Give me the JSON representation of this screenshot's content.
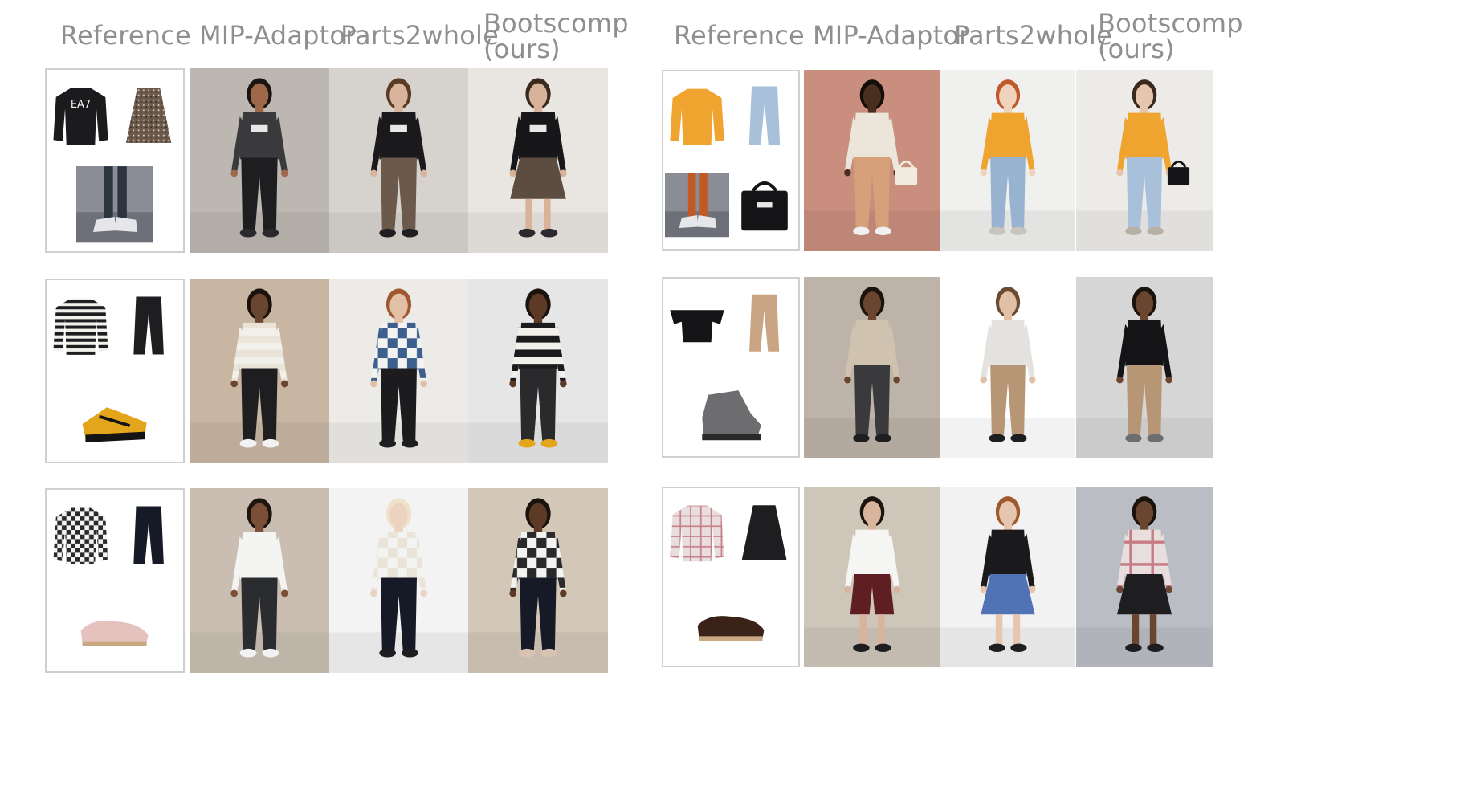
{
  "panels": [
    {
      "headers": [
        "Reference",
        "MIP-Adaptor",
        "Parts2whole",
        "Bootscomp",
        "(ours)"
      ],
      "rows": [
        {
          "ref_items": [
            {
              "kind": "top",
              "color": "#1b1b1d",
              "pattern": "logo",
              "label": "EA7"
            },
            {
              "kind": "skirt",
              "color": "#6b5a4c",
              "pattern": "speckle"
            },
            {
              "kind": "shoe-photo",
              "color": "#2c3440"
            }
          ],
          "photos": [
            {
              "bg": "#bdb7b1",
              "top": "#3a3a3c",
              "bottom": "#1e1e20",
              "shoe": "#2a2a2e",
              "skin": "#a0684b",
              "hair": "#1c1410",
              "top_pattern": "logo"
            },
            {
              "bg": "#d6d2cd",
              "top": "#1a1a1c",
              "bottom": "#6b5a4c",
              "shoe": "#1e1e20",
              "skin": "#d9b49c",
              "hair": "#5a3a22",
              "top_pattern": "logo"
            },
            {
              "bg": "#e9e5e0",
              "top": "#171719",
              "bottom": "#5d4d40",
              "shoe": "#2a2a2e",
              "skin": "#d8b39a",
              "hair": "#3a2a1e",
              "top_pattern": "logo",
              "bottom_kind": "skirt"
            }
          ]
        },
        {
          "ref_items": [
            {
              "kind": "top",
              "color": "#1e1e20",
              "pattern": "stripes"
            },
            {
              "kind": "pants",
              "color": "#1e1e20"
            },
            {
              "kind": "sneaker",
              "color": "#e3a51c"
            }
          ],
          "photos": [
            {
              "bg": "#c8b6a3",
              "top": "#e9e4d7",
              "bottom": "#1e1e20",
              "shoe": "#f2f2f2",
              "skin": "#6a4530",
              "hair": "#1a120c",
              "top_pattern": "stripes"
            },
            {
              "bg": "#ecebe8",
              "top": "#3d5f8e",
              "bottom": "#1c1c1e",
              "shoe": "#1e1e20",
              "skin": "#e2c0a6",
              "hair": "#a0582e",
              "top_pattern": "check"
            },
            {
              "bg": "#e6e6e6",
              "top": "#1b1b1d",
              "bottom": "#2a2a2c",
              "shoe": "#e3a51c",
              "skin": "#5c3a26",
              "hair": "#1a120c",
              "top_pattern": "stripes"
            }
          ]
        },
        {
          "ref_items": [
            {
              "kind": "top",
              "color": "#2a2a2c",
              "pattern": "check"
            },
            {
              "kind": "pants",
              "color": "#151a26"
            },
            {
              "kind": "loafer",
              "color": "#e6c2bf"
            }
          ],
          "photos": [
            {
              "bg": "#c9beb1",
              "top": "#f4f4f2",
              "bottom": "#2a2c30",
              "shoe": "#f2f2f2",
              "skin": "#7a4f36",
              "hair": "#1d140e",
              "top_pattern": "plain"
            },
            {
              "bg": "#f3f3f3",
              "top": "#e9e4d7",
              "bottom": "#151a26",
              "shoe": "#1e1e20",
              "skin": "#ecd3c1",
              "hair": "#efe2c8",
              "top_pattern": "check"
            },
            {
              "bg": "#d3c7b8",
              "top": "#2a2a2c",
              "bottom": "#151a26",
              "shoe": "#d8c2b2",
              "skin": "#5c3a26",
              "hair": "#1a120c",
              "top_pattern": "check"
            }
          ]
        }
      ]
    },
    {
      "headers": [
        "Reference",
        "MIP-Adaptor",
        "Parts2whole",
        "Bootscomp",
        "(ours)"
      ],
      "rows": [
        {
          "ref_items": [
            {
              "kind": "top",
              "color": "#f0a430",
              "pattern": "plain"
            },
            {
              "kind": "pants",
              "color": "#a8c0da"
            },
            {
              "kind": "shoe-photo",
              "color": "#c05a22"
            },
            {
              "kind": "bag",
              "color": "#141416"
            }
          ],
          "photos": [
            {
              "bg": "#c98e7d",
              "top": "#ebe6d9",
              "bottom": "#d5a07a",
              "shoe": "#f0f0f0",
              "skin": "#4a2e20",
              "hair": "#140e0a",
              "top_pattern": "plain",
              "bag": "#f1ebe0"
            },
            {
              "bg": "#f0f0ee",
              "top": "#f0a430",
              "bottom": "#98b3cf",
              "shoe": "#c9c4be",
              "skin": "#efd3bd",
              "hair": "#c1582a",
              "top_pattern": "plain"
            },
            {
              "bg": "#ecebe8",
              "top": "#f0a430",
              "bottom": "#a8c0da",
              "shoe": "#b8b0a6",
              "skin": "#e6c6ae",
              "hair": "#3a2a1e",
              "top_pattern": "plain",
              "bag": "#141416"
            }
          ]
        },
        {
          "ref_items": [
            {
              "kind": "top",
              "color": "#141416",
              "pattern": "offshoulder"
            },
            {
              "kind": "pants",
              "color": "#c9a583"
            },
            {
              "kind": "sandal",
              "color": "#6d6d6f"
            }
          ],
          "photos": [
            {
              "bg": "#bdb3a8",
              "top": "#cfc2ae",
              "bottom": "#3a3a3c",
              "shoe": "#1e1e20",
              "skin": "#6a4530",
              "hair": "#1a120c",
              "top_pattern": "plain"
            },
            {
              "bg": "#ffffff",
              "top": "#e4e2df",
              "bottom": "#b79676",
              "shoe": "#1e1e20",
              "skin": "#e2c0a6",
              "hair": "#6a4a30",
              "top_pattern": "plain"
            },
            {
              "bg": "#d6d6d6",
              "top": "#141416",
              "bottom": "#b79676",
              "shoe": "#6d6d6f",
              "skin": "#6a4530",
              "hair": "#1a120c",
              "top_pattern": "plain"
            }
          ]
        },
        {
          "ref_items": [
            {
              "kind": "top",
              "color": "#e8dede",
              "pattern": "plaid"
            },
            {
              "kind": "skirt",
              "color": "#1e1e20"
            },
            {
              "kind": "loafer",
              "color": "#3a2218"
            }
          ],
          "photos": [
            {
              "bg": "#cfc6ba",
              "top": "#f5f5f3",
              "bottom": "#5e1e22",
              "shoe": "#1e1e20",
              "skin": "#d9b49c",
              "hair": "#1d140e",
              "top_pattern": "plain",
              "bottom_kind": "shorts"
            },
            {
              "bg": "#f2f2f2",
              "top": "#1a1a1c",
              "bottom": "#5173b5",
              "shoe": "#1e1e20",
              "skin": "#e6c6ae",
              "hair": "#a0582e",
              "top_pattern": "plain",
              "bottom_kind": "skirt"
            },
            {
              "bg": "#babdc3",
              "top": "#e8dede",
              "bottom": "#1e1e20",
              "shoe": "#1e1e20",
              "skin": "#6a4530",
              "hair": "#1a120c",
              "top_pattern": "plaid",
              "bottom_kind": "skirt"
            }
          ]
        }
      ]
    }
  ]
}
